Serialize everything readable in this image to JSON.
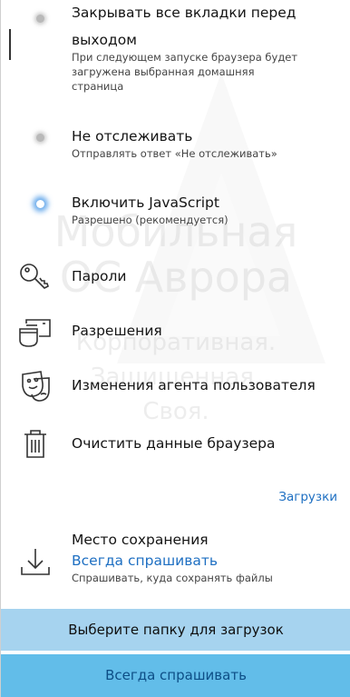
{
  "settings": {
    "close_tabs": {
      "title_line1": "Закрывать все вкладки перед",
      "title_line2": "выходом",
      "description_line1": "При следующем запуске браузера будет",
      "description_line2": "загружена выбранная домашняя",
      "description_line3": "страница",
      "enabled": false
    },
    "do_not_track": {
      "title": "Не отслеживать",
      "description": "Отправлять ответ «Не отслеживать»",
      "enabled": false
    },
    "javascript": {
      "title": "Включить JavaScript",
      "description": "Разрешено (рекомендуется)",
      "enabled": true
    },
    "passwords": {
      "title": "Пароли",
      "icon": "key-icon"
    },
    "permissions": {
      "title": "Разрешения",
      "icon": "window-permissions-icon"
    },
    "user_agent": {
      "title": "Изменения агента пользователя",
      "icon": "masks-icon"
    },
    "clear_data": {
      "title": "Очистить данные браузера",
      "icon": "trash-icon"
    }
  },
  "downloads": {
    "section_label": "Загрузки",
    "save_location": {
      "title": "Место сохранения",
      "value": "Всегда спрашивать",
      "description": "Спрашивать, куда сохранять файлы",
      "icon": "download-icon"
    },
    "choose_folder_label": "Выберите папку для загрузок",
    "always_ask_label": "Всегда спрашивать"
  },
  "watermark": {
    "line1": "Мобильная",
    "line2": "ОС Аврора",
    "line3": "Корпоративная.",
    "line4": "Защищенная.",
    "line5": "Своя."
  },
  "colors": {
    "accent": "#1e6fc2",
    "choose_folder_bg": "#a6d3ef",
    "always_ask_bg": "#62bde9",
    "toggle_on_glow": "#4696e6"
  }
}
